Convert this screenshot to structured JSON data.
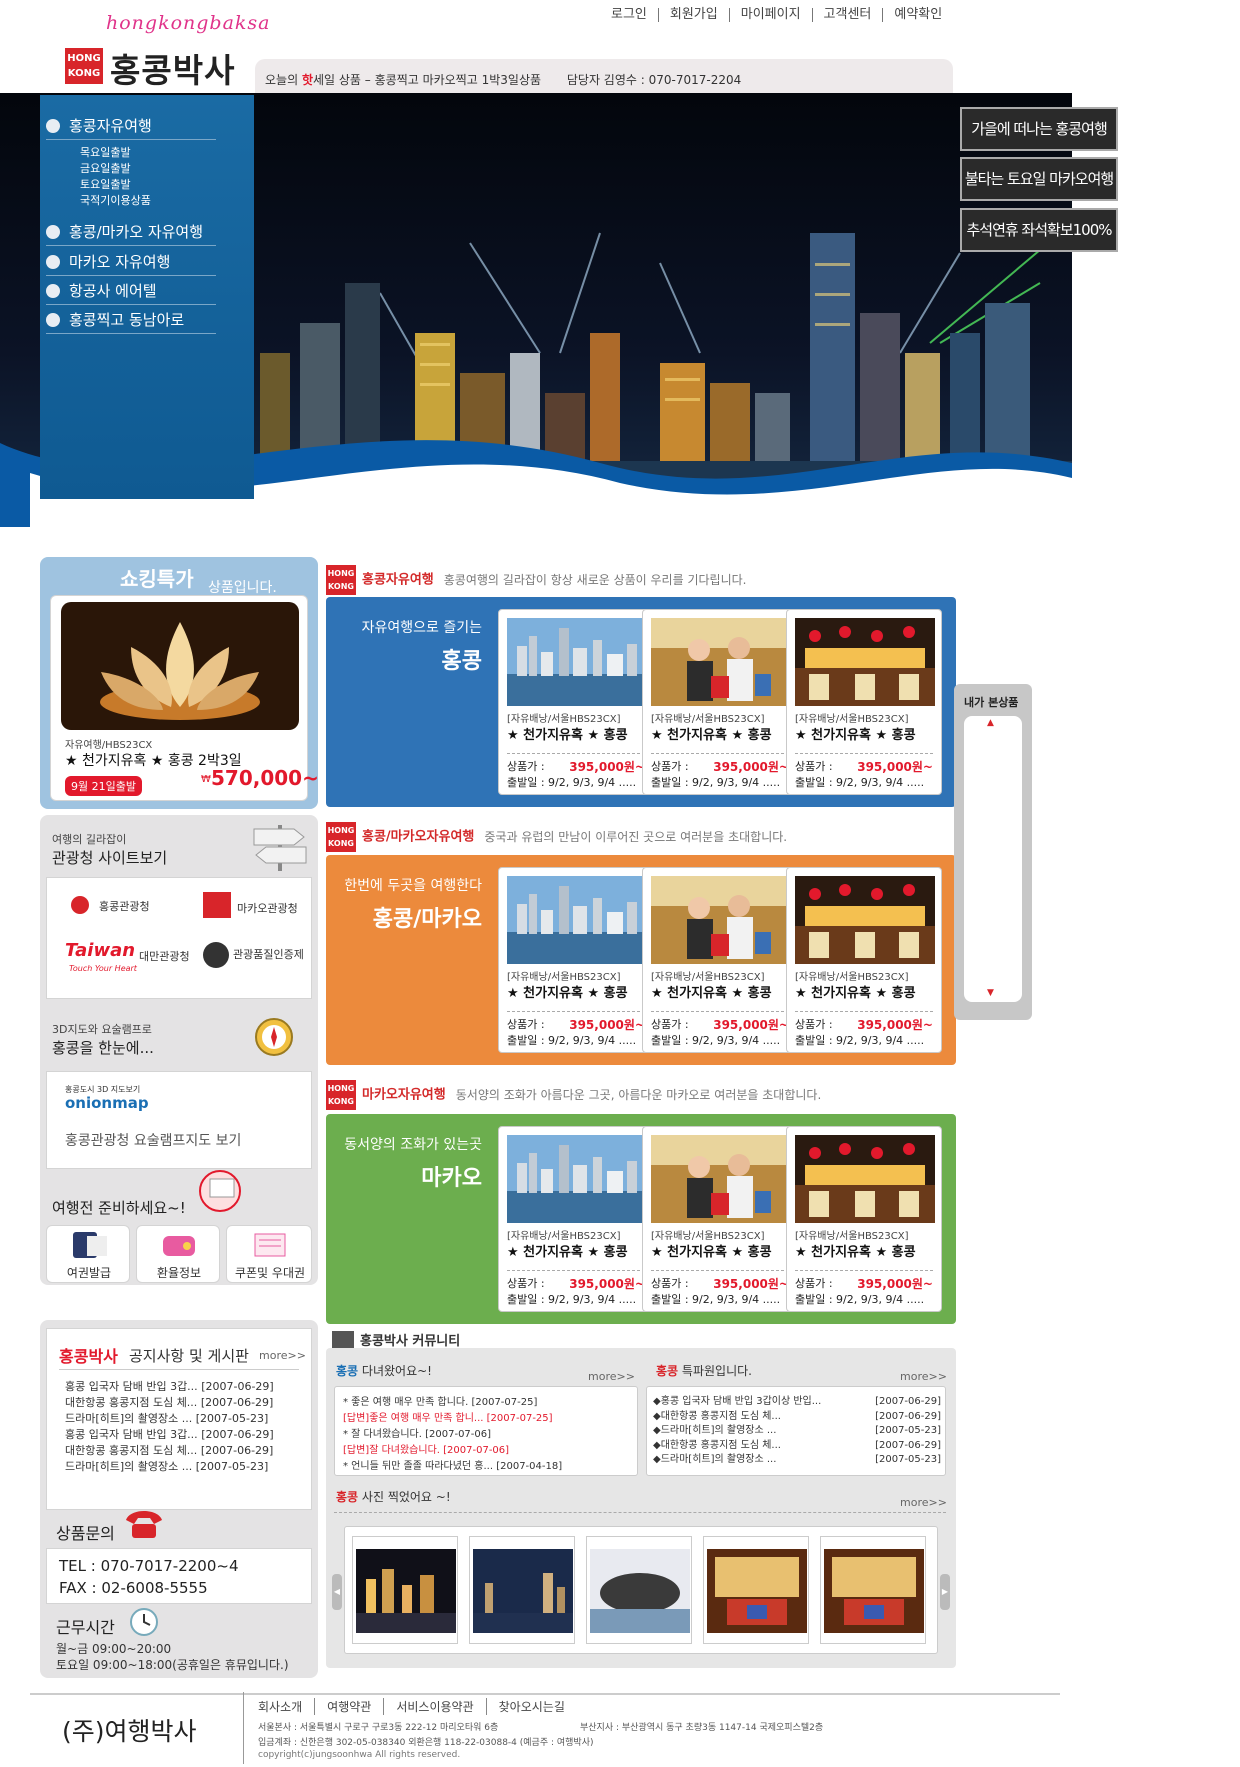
{
  "logo": {
    "script": "hongkongbaksa",
    "badge_line1": "HONG",
    "badge_line2": "KONG",
    "name": "홍콩박사"
  },
  "topnav": [
    "로그인",
    "회원가입",
    "마이페이지",
    "고객센터",
    "예약확인"
  ],
  "hot_deal": {
    "prefix": "오늘의",
    "hot": "핫",
    "suffix": "세일 상품 –",
    "product": "홍콩찍고 마카오찍고 1박3일상품",
    "contact": "담당자 김영수 : 070-7017-2204"
  },
  "side_menu": {
    "items": [
      "홍콩자유여행",
      "홍콩/마카오 자유여행",
      "마카오 자유여행",
      "항공사 에어텔",
      "홍콩찍고 동남아로"
    ],
    "sub_items": [
      "목요일출발",
      "금요일출발",
      "토요일출발",
      "국적기이용상품"
    ]
  },
  "promos": [
    "가을에 떠나는 홍콩여행",
    "불타는 토요일 마카오여행",
    "추석연휴 좌석확보100%"
  ],
  "shopping": {
    "title": "쇼킹특가",
    "subtitle": "상품입니다.",
    "code": "자유여행/HBS23CX",
    "name": "★ 천가지유혹 ★ 홍콩 2박3일",
    "date": "9월 21일출발",
    "price": "570,000~",
    "won": "₩"
  },
  "tourism": {
    "line1": "여행의 길라잡이",
    "line2": "관광청 사이트보기",
    "links": [
      "홍콩관광청",
      "마카오관광청",
      "대만관광청",
      "관광품질인증제"
    ],
    "taiwan_sub": "Touch Your Heart"
  },
  "map3d": {
    "line1": "3D지도와 요술램프로",
    "line2": "홍콩을 한눈에...",
    "brand_top": "홍콩도시 3D 지도보기",
    "brand": "onionmap",
    "link": "홍콩관광청 요술램프지도 보기"
  },
  "prep": {
    "title": "여행전 준비하세요~!",
    "items": [
      "여권발급",
      "환율정보",
      "쿠폰및 우대권"
    ]
  },
  "notice": {
    "brand": "홍콩박사",
    "title": "공지사항 및 게시판",
    "more": "more>>",
    "items": [
      {
        "text": "홍콩 입국자 담배 반입 3갑...",
        "date": "[2007-06-29]"
      },
      {
        "text": "대한항콩 홍콩지점 도심 체...",
        "date": "[2007-06-29]"
      },
      {
        "text": "드라마[히트]의 촬영장소 ...",
        "date": "[2007-05-23]"
      },
      {
        "text": "홍콩 입국자 담배 반입 3갑...",
        "date": "[2007-06-29]"
      },
      {
        "text": "대한항콩 홍콩지점 도심 체...",
        "date": "[2007-06-29]"
      },
      {
        "text": "드라마[히트]의 촬영장소 ...",
        "date": "[2007-05-23]"
      }
    ]
  },
  "inquiry": {
    "title": "상품문의",
    "tel": "TEL : 070-7017-2200~4",
    "fax": "FAX : 02-6008-5555",
    "hours_title": "근무시간",
    "weekday": "월~금  09:00~20:00",
    "saturday": "토요일  09:00~18:00(공휴일은 휴뮤입니다.)"
  },
  "sections": [
    {
      "title": "홍콩자유여행",
      "desc": "홍콩여행의 길라잡이 항상 새로운 상품이 우리를 기다립니다.",
      "band_line1": "자유여행으로 즐기는",
      "band_line2": "홍콩",
      "color": "#2f73b6"
    },
    {
      "title": "홍콩/마카오자유여행",
      "desc": "중국과 유럽의 만남이 이루어진 곳으로 여러분을 초대합니다.",
      "band_line1": "한번에 두곳을 여행한다",
      "band_line2": "홍콩/마카오",
      "color": "#ec8a3c"
    },
    {
      "title": "마카오자유여행",
      "desc": "동서양의 조화가 아름다운 그곳, 아름다운 마카오로 여러분을 초대합니다.",
      "band_line1": "동서양의 조화가 있는곳",
      "band_line2": "마카오",
      "color": "#6cae4e"
    }
  ],
  "product": {
    "code": "[자유배낭/서울HBS23CX]",
    "name": "★ 천가지유혹 ★ 홍콩",
    "price_label": "상품가 :",
    "price": "395,000원~",
    "date": "출발일 : 9/2, 9/3, 9/4 ....."
  },
  "viewed": {
    "title": "내가 본상품",
    "up": "▲",
    "down": "▼"
  },
  "community": {
    "title": "홍콩박사 커뮤니티",
    "visited": {
      "brand": "홍콩",
      "title": "다녀왔어요~!",
      "more": "more>>",
      "items": [
        "* 좋은 여행 매우 만족 합니다. [2007-07-25]",
        "[답변]좋은 여행 매우 만족 합니... [2007-07-25]",
        "* 잘 다녀왔습니다. [2007-07-06]",
        "[답변]잘 다녀왔습니다. [2007-07-06]",
        "* 언니들 뒤만 졸졸 따라다녔던 홍... [2007-04-18]"
      ]
    },
    "reporter": {
      "brand": "홍콩",
      "title": "특파원입니다.",
      "more": "more>>",
      "items": [
        {
          "text": "◆홍콩 입국자 담배 반입 3갑이상 반입...",
          "date": "[2007-06-29]"
        },
        {
          "text": "◆대한항콩 홍콩지점 도심 체...",
          "date": "[2007-06-29]"
        },
        {
          "text": "◆드라마[히트]의 촬영장소 ...",
          "date": "[2007-05-23]"
        },
        {
          "text": "◆대한항콩 홍콩지점 도심 체...",
          "date": "[2007-06-29]"
        },
        {
          "text": "◆드라마[히트]의 촬영장소 ...",
          "date": "[2007-05-23]"
        }
      ]
    },
    "photos": {
      "brand": "홍콩",
      "title": "사진 찍었어요 ~!",
      "more": "more>>"
    }
  },
  "footer": {
    "company": "(주)여행박사",
    "links": [
      "회사소개",
      "여행약관",
      "서비스이용약관",
      "찾아오시는길"
    ],
    "seoul": "서울본사 :  서울특별시 구로구 구로3동 222-12 마리오타워 6층",
    "busan": "부산지사 :  부산광역시 동구 초량3동 1147-14 국제오피스텔2층",
    "bank": "입금계좌 :  신한은행 302-05-038340     외환은행  118-22-03088-4  (예금주 :  여행박사)",
    "copyright": "copyright(c)jungsoonhwa All rights reserved."
  }
}
